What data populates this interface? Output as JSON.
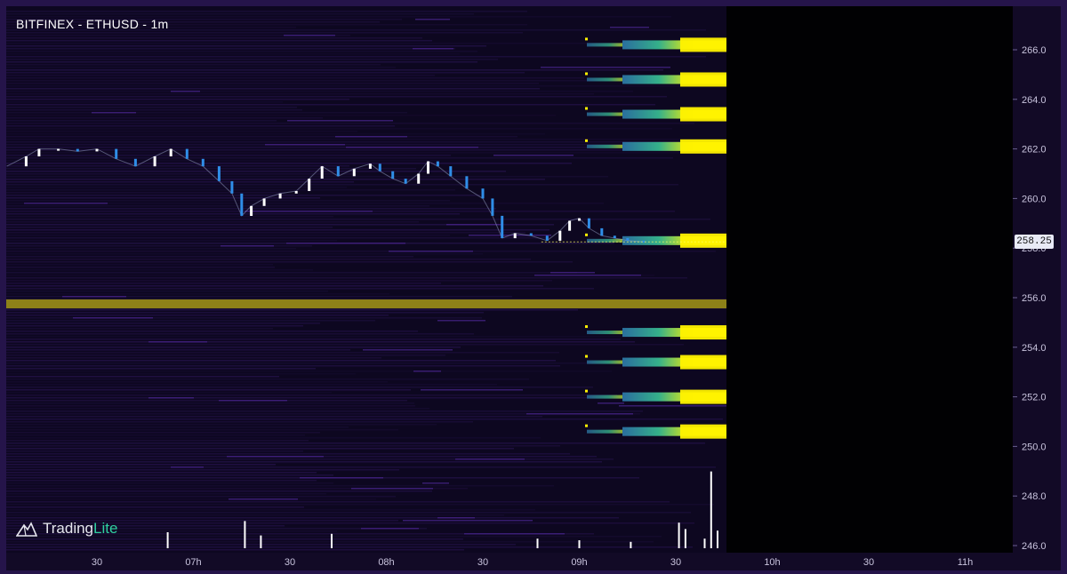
{
  "header": {
    "title": "BITFINEX - ETHUSD - 1m"
  },
  "branding": {
    "name_part1": "Trading",
    "name_part2": "Lite",
    "logo_icon": "mountain-logo-icon"
  },
  "colors": {
    "background": "#05030c",
    "frame": "#25144a",
    "heat_low": "#2c1658",
    "heat_mid": "#3d7ea8",
    "heat_high": "#fff200",
    "candle_up": "#ffffff",
    "candle_down": "#2f8ee8",
    "volume": "#ffffff"
  },
  "current_price": {
    "label": "258.25",
    "value": 258.25
  },
  "chart_data": {
    "type": "heatmap",
    "title": "BITFINEX - ETHUSD - 1m",
    "ylim": [
      245.6,
      267.3
    ],
    "y_ticks": [
      246.0,
      248.0,
      250.0,
      252.0,
      254.0,
      256.0,
      258.0,
      260.0,
      262.0,
      264.0,
      266.0
    ],
    "y_tick_labels": [
      "246.0",
      "248.0",
      "250.0",
      "252.0",
      "254.0",
      "256.0",
      "258.0",
      "260.0",
      "262.0",
      "264.0",
      "266.0"
    ],
    "x_tick_labels": [
      "30",
      "07h",
      "30",
      "08h",
      "30",
      "09h",
      "30",
      "10h",
      "30",
      "11h"
    ],
    "x_tick_times": [
      "06:30",
      "07:00",
      "07:30",
      "08:00",
      "08:30",
      "09:00",
      "09:30",
      "10:00",
      "10:30",
      "11:00"
    ],
    "series": [
      {
        "type": "line",
        "points": [
          [
            "06:02",
            261.3
          ],
          [
            "06:08",
            261.7
          ],
          [
            "06:12",
            262.0
          ],
          [
            "06:18",
            262.0
          ],
          [
            "06:24",
            261.9
          ],
          [
            "06:30",
            262.0
          ],
          [
            "06:36",
            261.6
          ],
          [
            "06:42",
            261.3
          ],
          [
            "06:48",
            261.7
          ],
          [
            "06:53",
            262.0
          ],
          [
            "06:58",
            261.6
          ],
          [
            "07:03",
            261.3
          ],
          [
            "07:08",
            260.7
          ],
          [
            "07:12",
            260.2
          ],
          [
            "07:15",
            259.3
          ],
          [
            "07:18",
            259.7
          ],
          [
            "07:22",
            260.0
          ],
          [
            "07:27",
            260.2
          ],
          [
            "07:32",
            260.3
          ],
          [
            "07:36",
            260.8
          ],
          [
            "07:40",
            261.3
          ],
          [
            "07:45",
            260.9
          ],
          [
            "07:50",
            261.2
          ],
          [
            "07:55",
            261.4
          ],
          [
            "07:58",
            261.1
          ],
          [
            "08:02",
            260.8
          ],
          [
            "08:06",
            260.6
          ],
          [
            "08:10",
            261.0
          ],
          [
            "08:13",
            261.5
          ],
          [
            "08:16",
            261.3
          ],
          [
            "08:20",
            260.9
          ],
          [
            "08:25",
            260.4
          ],
          [
            "08:30",
            260.0
          ],
          [
            "08:33",
            259.3
          ],
          [
            "08:36",
            258.4
          ],
          [
            "08:40",
            258.6
          ],
          [
            "08:45",
            258.5
          ],
          [
            "08:50",
            258.3
          ],
          [
            "08:54",
            258.7
          ],
          [
            "08:57",
            259.1
          ],
          [
            "09:00",
            259.2
          ],
          [
            "09:03",
            258.8
          ],
          [
            "09:07",
            258.5
          ],
          [
            "09:11",
            258.4
          ],
          [
            "09:15",
            258.3
          ],
          [
            "09:20",
            258.25
          ]
        ]
      },
      {
        "type": "bar",
        "name": "volume",
        "points": [
          [
            "06:52",
            1.0
          ],
          [
            "07:16",
            1.7
          ],
          [
            "07:21",
            0.8
          ],
          [
            "07:43",
            0.9
          ],
          [
            "08:47",
            0.6
          ],
          [
            "09:00",
            0.5
          ],
          [
            "09:16",
            0.4
          ],
          [
            "09:31",
            1.6
          ],
          [
            "09:33",
            1.2
          ],
          [
            "09:39",
            0.6
          ],
          [
            "09:41",
            4.8
          ],
          [
            "09:43",
            1.1
          ]
        ]
      }
    ],
    "liquidity_bands": [
      {
        "price": 266.2
      },
      {
        "price": 264.8
      },
      {
        "price": 263.4
      },
      {
        "price": 262.1
      },
      {
        "price": 258.3
      },
      {
        "price": 255.75
      },
      {
        "price": 254.6
      },
      {
        "price": 253.4
      },
      {
        "price": 252.0
      },
      {
        "price": 250.6
      }
    ]
  }
}
